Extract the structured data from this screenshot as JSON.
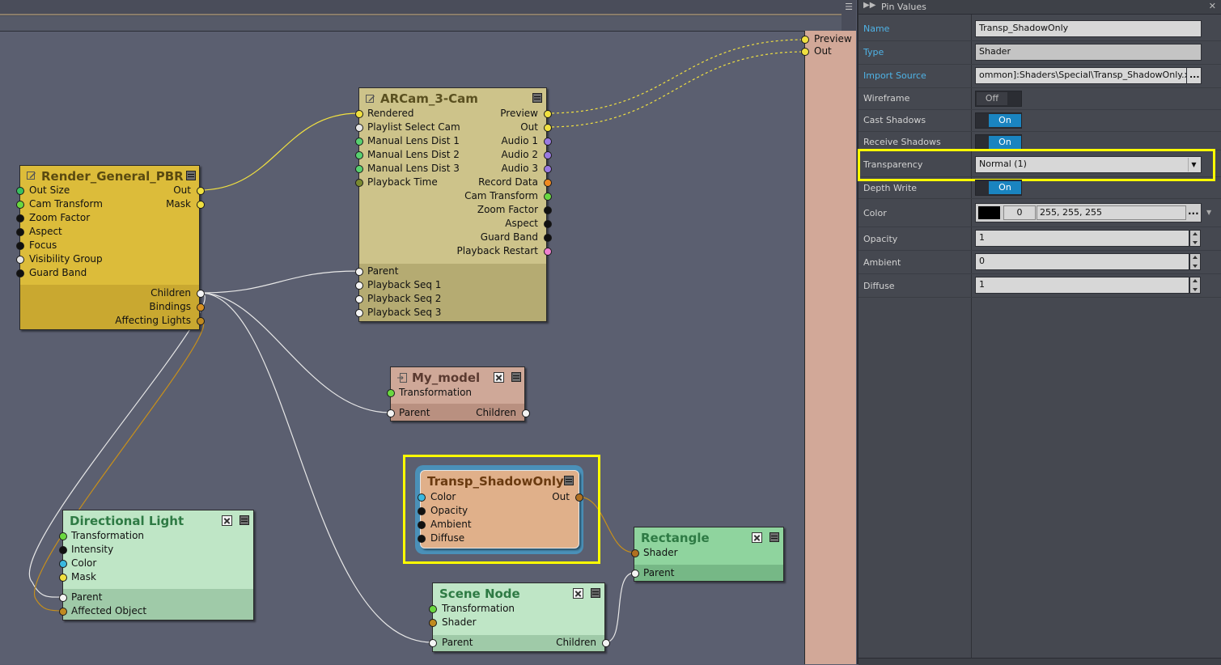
{
  "graph": {
    "top_right_nodes": [
      {
        "label": "Preview"
      },
      {
        "label": "Out"
      }
    ],
    "nodes": {
      "render_general": {
        "title": "Render_General_PBR",
        "inputs": [
          "Out Size",
          "Cam Transform",
          "Zoom Factor",
          "Aspect",
          "Focus",
          "Visibility Group",
          "Guard Band"
        ],
        "outputs": [
          "Out",
          "Mask"
        ],
        "section_outputs": [
          "Children",
          "Bindings",
          "Affecting Lights"
        ]
      },
      "arcam": {
        "title": "ARCam_3-Cam",
        "inputs": [
          "Rendered",
          "Playlist Select Cam",
          "Manual Lens Dist 1",
          "Manual Lens Dist 2",
          "Manual Lens Dist 3",
          "Playback Time"
        ],
        "outputs": [
          "Preview",
          "Out",
          "Audio 1",
          "Audio 2",
          "Audio 3",
          "Record Data",
          "Cam Transform",
          "Zoom Factor",
          "Aspect",
          "Guard Band",
          "Playback Restart"
        ],
        "section_inputs": [
          "Parent",
          "Playback Seq 1",
          "Playback Seq 2",
          "Playback Seq 3"
        ]
      },
      "my_model": {
        "title": "My_model",
        "inputs": [
          "Transformation"
        ],
        "section_left": "Parent",
        "section_right": "Children"
      },
      "transp": {
        "title": "Transp_ShadowOnly",
        "inputs": [
          "Color",
          "Opacity",
          "Ambient",
          "Diffuse"
        ],
        "outputs": [
          "Out"
        ]
      },
      "directional_light": {
        "title": "Directional Light",
        "inputs": [
          "Transformation",
          "Intensity",
          "Color",
          "Mask"
        ],
        "section_inputs": [
          "Parent",
          "Affected Object"
        ]
      },
      "scene_node": {
        "title": "Scene Node",
        "inputs": [
          "Transformation",
          "Shader"
        ],
        "section_left": "Parent",
        "section_right": "Children"
      },
      "rectangle": {
        "title": "Rectangle",
        "inputs": [
          "Shader"
        ],
        "section_left": "Parent"
      }
    }
  },
  "panel": {
    "title": "Pin Values",
    "rows": {
      "name": {
        "label": "Name",
        "value": "Transp_ShadowOnly"
      },
      "type": {
        "label": "Type",
        "value": "Shader"
      },
      "import_source": {
        "label": "Import Source",
        "value": "ommon]:Shaders\\Special\\Transp_ShadowOnly.xshad"
      },
      "wireframe": {
        "label": "Wireframe",
        "value": "Off"
      },
      "cast_shadows": {
        "label": "Cast Shadows",
        "value": "On"
      },
      "receive_shadows": {
        "label": "Receive Shadows",
        "value": "On"
      },
      "transparency": {
        "label": "Transparency",
        "value": "Normal (1)"
      },
      "depth_write": {
        "label": "Depth Write",
        "value": "On"
      },
      "color": {
        "label": "Color",
        "alpha": "0",
        "value": "255, 255, 255",
        "swatch": "#000000"
      },
      "opacity": {
        "label": "Opacity",
        "value": "1"
      },
      "ambient": {
        "label": "Ambient",
        "value": "0"
      },
      "diffuse": {
        "label": "Diffuse",
        "value": "1"
      }
    },
    "ellipsis": "..."
  },
  "colors": {
    "highlight": "#ffff00",
    "accent_on": "#1a84c0",
    "link": "#4fb3e6"
  }
}
